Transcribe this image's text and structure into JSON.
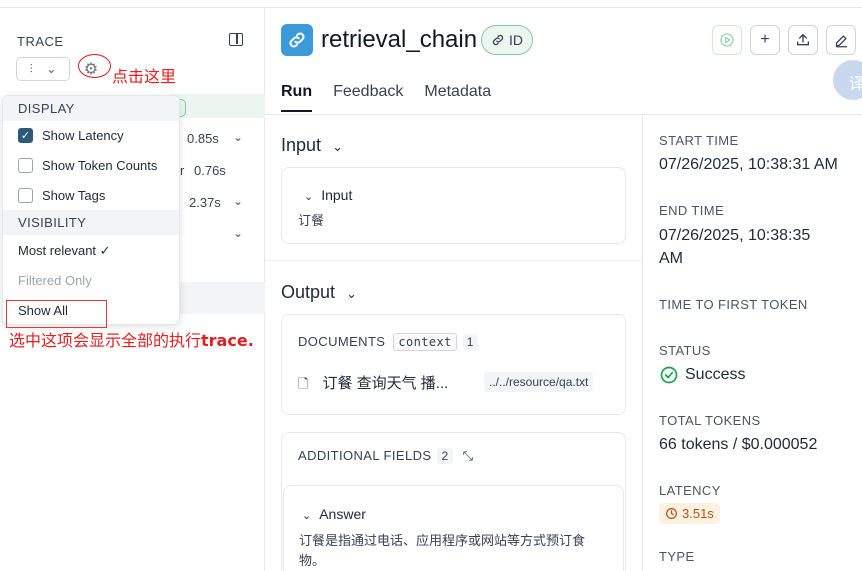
{
  "sidebar": {
    "title": "TRACE",
    "latencies": [
      "0.85s",
      "0.76s",
      "2.37s"
    ],
    "partial_name_char": "r"
  },
  "menu": {
    "display_header": "DISPLAY",
    "show_latency": "Show Latency",
    "show_token_counts": "Show Token Counts",
    "show_tags": "Show Tags",
    "visibility_header": "VISIBILITY",
    "most_relevant": "Most relevant ✓",
    "filtered_only": "Filtered Only",
    "show_all": "Show All"
  },
  "annotations": {
    "click_here": "点击这里",
    "select_note_prefix": "选中这项会显示全部的执行",
    "select_note_bold": "trace."
  },
  "header": {
    "title": "retrieval_chain",
    "id_badge": "ID",
    "translate_glyph": "译"
  },
  "tabs": [
    "Run",
    "Feedback",
    "Metadata"
  ],
  "input": {
    "section_label": "Input",
    "card_label": "Input",
    "value": "订餐"
  },
  "output": {
    "section_label": "Output",
    "documents_label": "DOCUMENTS",
    "context_chip": "context",
    "documents_count": "1",
    "doc_title": "订餐 查询天气 播...",
    "doc_source": "../../resource/qa.txt",
    "additional_fields_label": "ADDITIONAL FIELDS",
    "additional_count": "2",
    "answer_label": "Answer",
    "answer_line1": "订餐是指通过电话、应用程序或网站等方式预订食",
    "answer_line2": "物。"
  },
  "meta": {
    "start_time_label": "START TIME",
    "start_time": "07/26/2025, 10:38:31 AM",
    "end_time_label": "END TIME",
    "end_time_line1": "07/26/2025, 10:38:35",
    "end_time_line2": "AM",
    "ttft_label": "TIME TO FIRST TOKEN",
    "status_label": "STATUS",
    "status": "Success",
    "total_tokens_label": "TOTAL TOKENS",
    "total_tokens": "66 tokens / $0.000052",
    "latency_label": "LATENCY",
    "latency": "3.51s",
    "type_label": "TYPE"
  },
  "colors": {
    "accent_blue": "#3b9ad9",
    "success_green": "#16a34a",
    "annotation_red": "#e02020",
    "latency_orange": "#b45309"
  }
}
